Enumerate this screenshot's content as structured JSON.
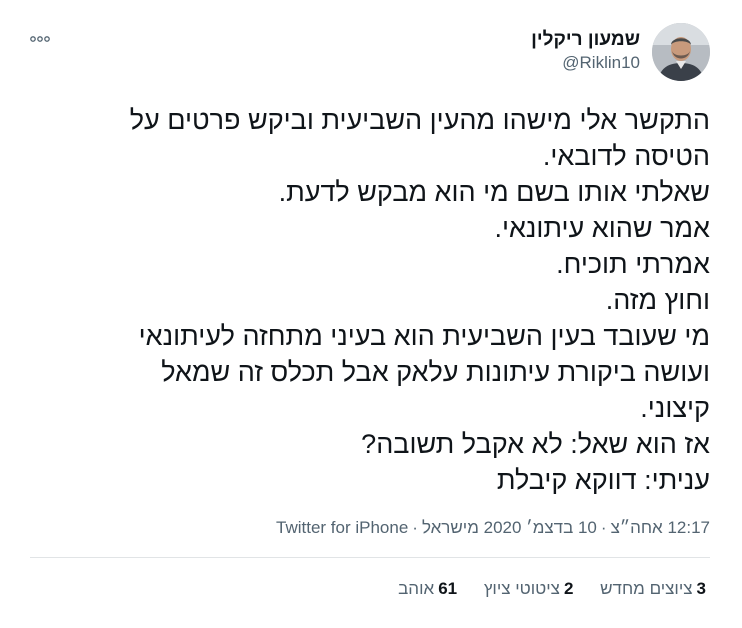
{
  "author": {
    "display_name": "שמעון ריקלין",
    "handle": "@Riklin10",
    "avatar_icon": "user-photo"
  },
  "tweet": {
    "lines": [
      "התקשר אלי מישהו מהעין השביעית וביקש פרטים על",
      "הטיסה לדובאי.",
      "שאלתי אותו בשם מי הוא מבקש לדעת.",
      "אמר שהוא עיתונאי.",
      "אמרתי תוכיח.",
      "וחוץ מזה.",
      "מי שעובד בעין השביעית הוא בעיני מתחזה לעיתונאי",
      "ועושה ביקורת עיתונות עלאק אבל תכלס זה שמאל",
      "קיצוני.",
      "אז הוא שאל: לא אקבל תשובה?",
      "עניתי: דווקא קיבלת"
    ]
  },
  "meta": {
    "time": "12:17 אחה״צ",
    "separator": "·",
    "date": "10 בדצמ׳ 2020 מישראל",
    "source": "Twitter for iPhone"
  },
  "stats": {
    "retweets_count": "3",
    "retweets_label": "ציוצים מחדש",
    "quotes_count": "2",
    "quotes_label": "ציטוטי ציוץ",
    "likes_count": "61",
    "likes_label": "אוהב"
  },
  "colors": {
    "text": "#0f1419",
    "secondary": "#536471",
    "divider": "#e1e4e6"
  },
  "icons": {
    "more": "more-dots-icon"
  }
}
